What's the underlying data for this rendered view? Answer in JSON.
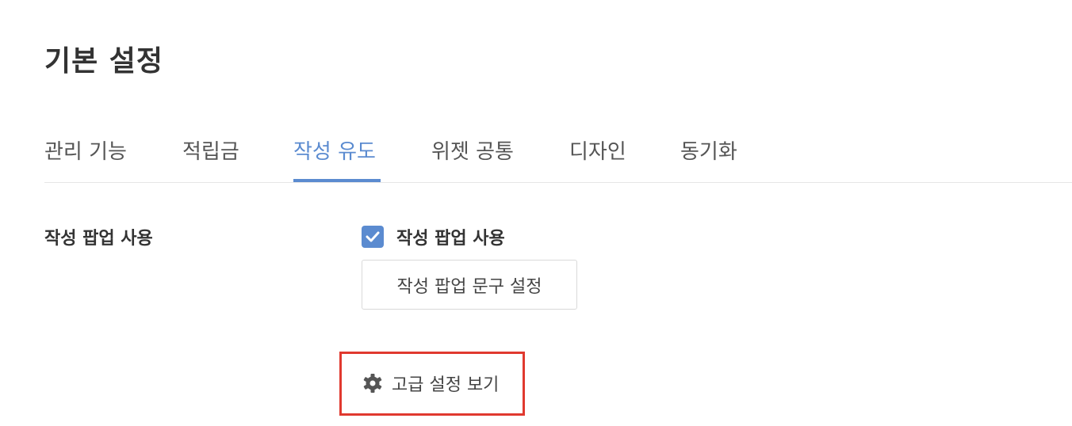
{
  "page": {
    "title": "기본 설정"
  },
  "tabs": [
    {
      "label": "관리 기능",
      "active": false
    },
    {
      "label": "적립금",
      "active": false
    },
    {
      "label": "작성 유도",
      "active": true
    },
    {
      "label": "위젯 공통",
      "active": false
    },
    {
      "label": "디자인",
      "active": false
    },
    {
      "label": "동기화",
      "active": false
    }
  ],
  "setting": {
    "label": "작성 팝업 사용",
    "checkbox": {
      "label": "작성 팝업 사용",
      "checked": true
    },
    "popup_text_button": "작성 팝업 문구 설정",
    "advanced_link": "고급 설정 보기"
  },
  "colors": {
    "accent": "#5b8bd0",
    "highlight_border": "#e0392f",
    "text": "#333333"
  },
  "icons": {
    "checkbox": "check-icon",
    "advanced": "gear-icon"
  }
}
